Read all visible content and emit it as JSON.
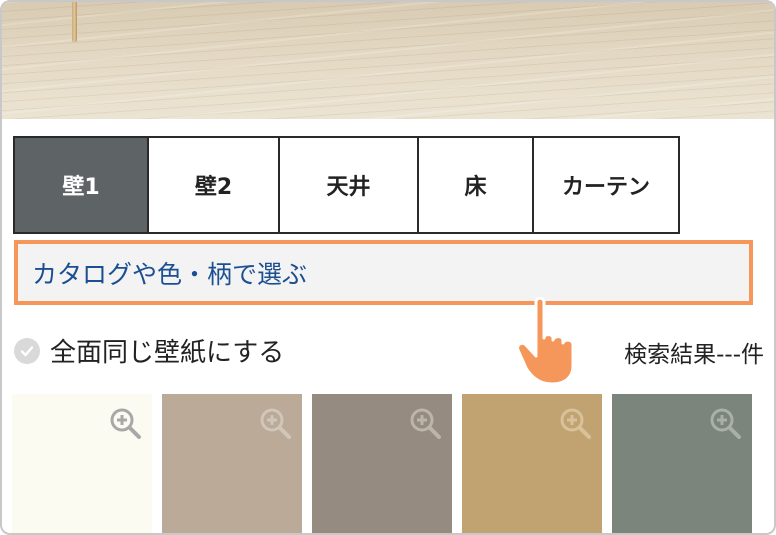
{
  "tabs": [
    {
      "label": "壁1",
      "active": true
    },
    {
      "label": "壁2",
      "active": false
    },
    {
      "label": "天井",
      "active": false
    },
    {
      "label": "床",
      "active": false
    },
    {
      "label": "カーテン",
      "active": false
    }
  ],
  "catalog_button": {
    "label": "カタログや色・柄で選ぶ"
  },
  "same_wallpaper": {
    "label": "全面同じ壁紙にする",
    "checked": false
  },
  "search_result": {
    "label": "検索結果---件"
  },
  "swatches": [
    {
      "color": "#fbfbf1",
      "icon": "zoom-in-icon"
    },
    {
      "color": "#bbaa98",
      "icon": "zoom-in-icon"
    },
    {
      "color": "#958b80",
      "icon": "zoom-in-icon"
    },
    {
      "color": "#c1a271",
      "icon": "zoom-in-icon"
    },
    {
      "color": "#7c857b",
      "icon": "zoom-in-icon"
    }
  ],
  "colors": {
    "accent_border": "#f5965a",
    "link_text": "#1b4f92",
    "active_tab": "#5e6466",
    "hand_pointer": "#f5965a"
  }
}
